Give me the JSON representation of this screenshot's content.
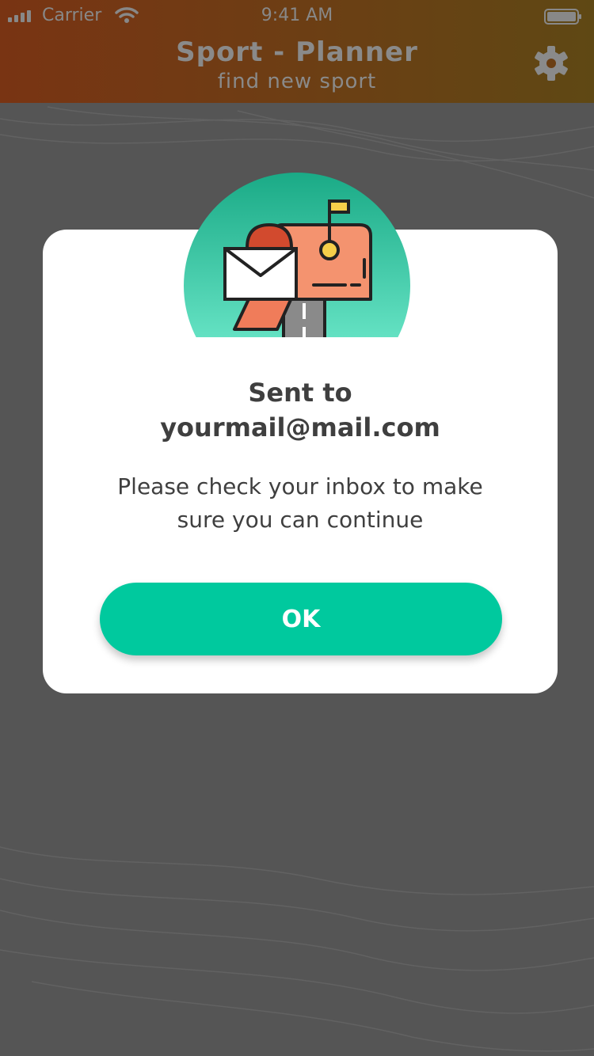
{
  "status_bar": {
    "carrier": "Carrier",
    "time": "9:41 AM"
  },
  "header": {
    "title": "Sport - Planner",
    "subtitle": "find new sport",
    "settings_icon": "gear-icon"
  },
  "modal": {
    "illustration_icon": "mailbox-icon",
    "heading_line1": "Sent to",
    "heading_line2": "yourmail@mail.com",
    "message_line1": "Please check your inbox to make",
    "message_line2": "sure you can continue",
    "ok_label": "OK"
  },
  "colors": {
    "accent": "#00c99e",
    "overlay": "#555555",
    "header_start": "#793413",
    "header_end": "#5f4814"
  }
}
